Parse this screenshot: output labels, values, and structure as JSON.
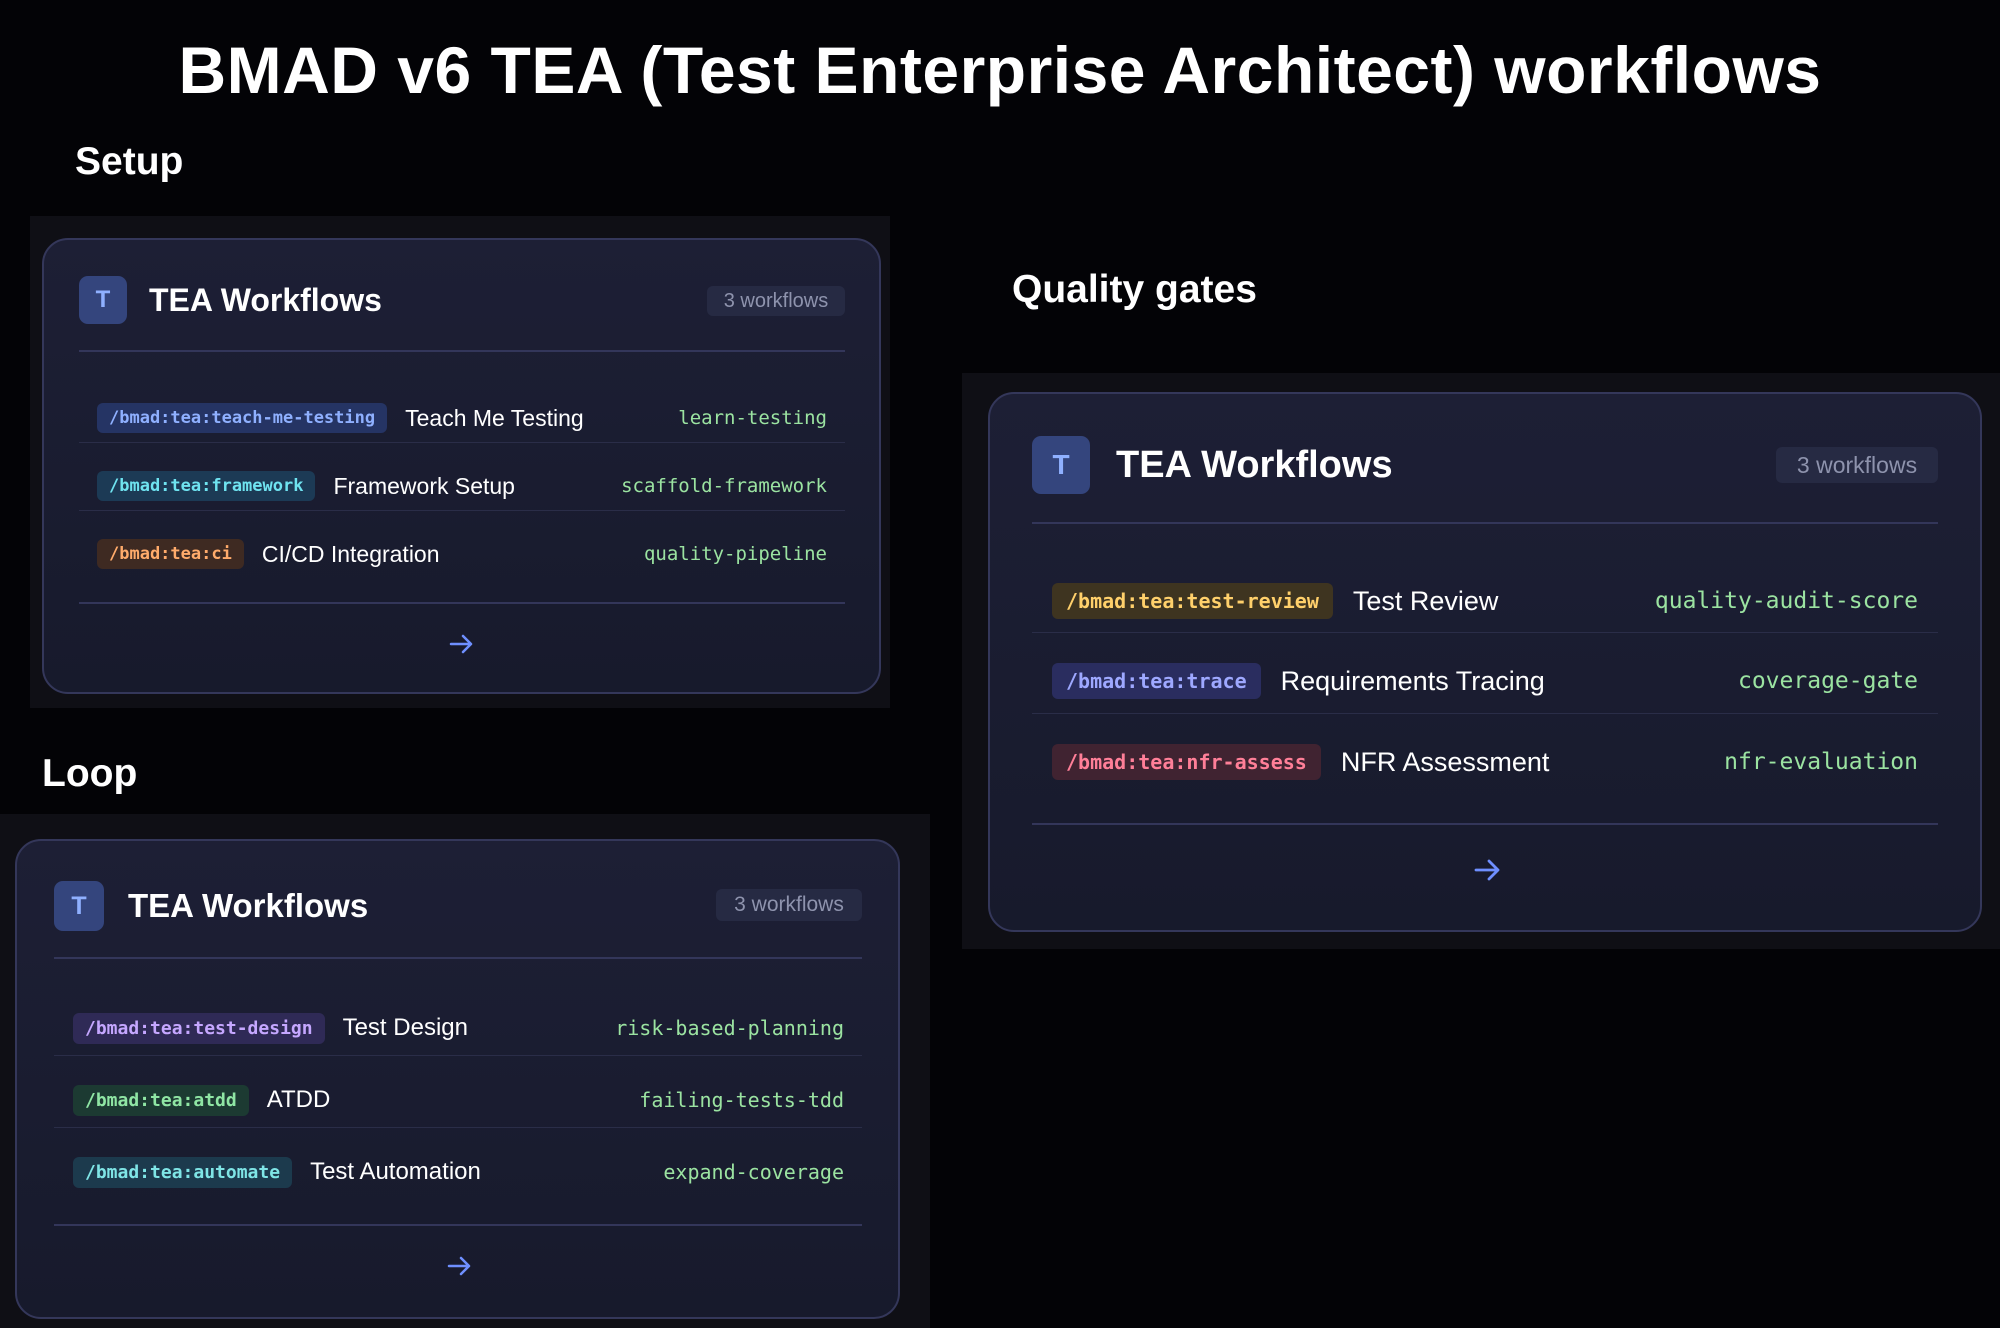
{
  "title": "BMAD v6 TEA (Test Enterprise Architect) workflows",
  "sections": {
    "setup": {
      "label": "Setup",
      "card_title": "TEA Workflows",
      "avatar": "T",
      "count": "3 workflows",
      "rows": [
        {
          "cmd": "/bmad:tea:teach-me-testing",
          "label": "Teach Me Testing",
          "tag": "learn-testing",
          "color": "#8fb0ff"
        },
        {
          "cmd": "/bmad:tea:framework",
          "label": "Framework Setup",
          "tag": "scaffold-framework",
          "color": "#6fe3f0"
        },
        {
          "cmd": "/bmad:tea:ci",
          "label": "CI/CD Integration",
          "tag": "quality-pipeline",
          "color": "#ffab6b"
        }
      ],
      "arrow_icon": "arrow-right-icon"
    },
    "loop": {
      "label": "Loop",
      "card_title": "TEA Workflows",
      "avatar": "T",
      "count": "3 workflows",
      "rows": [
        {
          "cmd": "/bmad:tea:test-design",
          "label": "Test Design",
          "tag": "risk-based-planning",
          "color": "#c5a7ff"
        },
        {
          "cmd": "/bmad:tea:atdd",
          "label": "ATDD",
          "tag": "failing-tests-tdd",
          "color": "#8fe6a4"
        },
        {
          "cmd": "/bmad:tea:automate",
          "label": "Test Automation",
          "tag": "expand-coverage",
          "color": "#7fe5e6"
        }
      ],
      "arrow_icon": "arrow-right-icon"
    },
    "gates": {
      "label": "Quality gates",
      "card_title": "TEA Workflows",
      "avatar": "T",
      "count": "3 workflows",
      "rows": [
        {
          "cmd": "/bmad:tea:test-review",
          "label": "Test Review",
          "tag": "quality-audit-score",
          "color": "#ffd06b"
        },
        {
          "cmd": "/bmad:tea:trace",
          "label": "Requirements Tracing",
          "tag": "coverage-gate",
          "color": "#9ea8ff"
        },
        {
          "cmd": "/bmad:tea:nfr-assess",
          "label": "NFR Assessment",
          "tag": "nfr-evaluation",
          "color": "#ff7f98"
        }
      ],
      "arrow_icon": "arrow-right-icon"
    }
  },
  "colors": {
    "background": "#030306",
    "card": "#1b1d32",
    "tag_green": "#9be3a1",
    "arrow_blue": "#6f8fff"
  }
}
